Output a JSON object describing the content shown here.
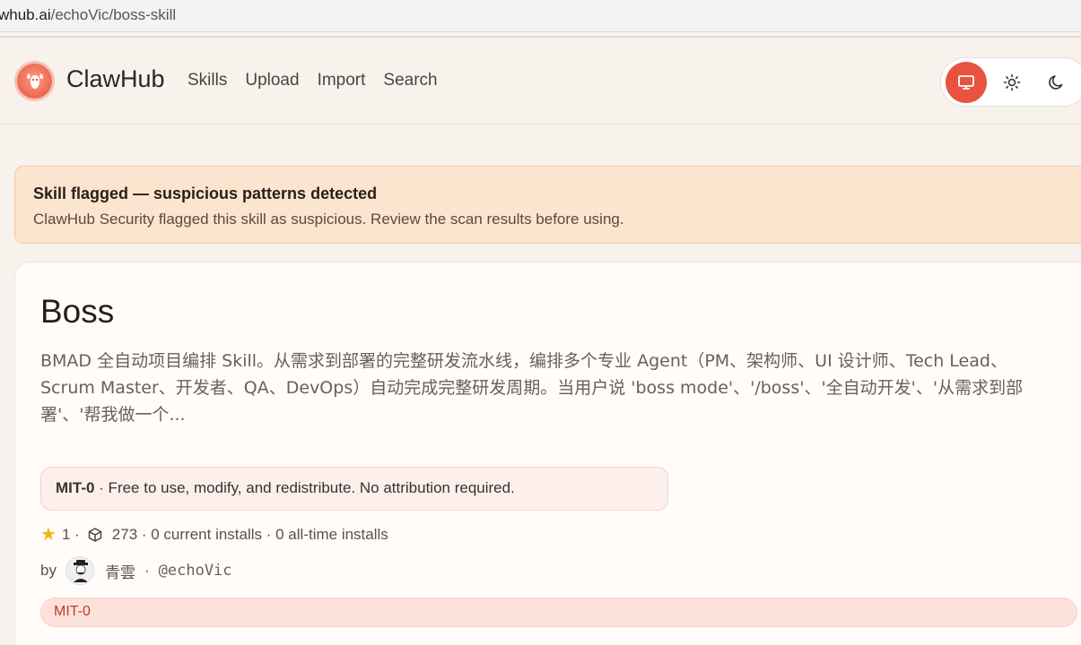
{
  "browser": {
    "url_prefix": "whub.ai",
    "url_path": "/echoVic/boss-skill"
  },
  "header": {
    "brand": "ClawHub",
    "nav": [
      "Skills",
      "Upload",
      "Import",
      "Search"
    ],
    "theme_modes": [
      "monitor-icon",
      "sun-icon",
      "moon-icon"
    ],
    "active_theme": "system"
  },
  "banner": {
    "title": "Skill flagged — suspicious patterns detected",
    "text": "ClawHub Security flagged this skill as suspicious. Review the scan results before using."
  },
  "skill": {
    "title": "Boss",
    "description": "BMAD 全自动项目编排 Skill。从需求到部署的完整研发流水线，编排多个专业 Agent（PM、架构师、UI 设计师、Tech Lead、Scrum Master、开发者、QA、DevOps）自动完成完整研发周期。当用户说 'boss mode'、'/boss'、'全自动开发'、'从需求到部署'、'帮我做一个...",
    "license_name": "MIT-0",
    "license_text": " · Free to use, modify, and redistribute. No attribution required.",
    "stars": "1 ·",
    "installs": "273 · 0 current installs · 0 all-time installs",
    "by_label": "by",
    "author": "青雲",
    "separator": "·",
    "handle": "@echoVic",
    "tag": "MIT-0"
  },
  "colors": {
    "accent": "#e8533f",
    "banner_bg": "#fbe5cf",
    "tag_text": "#c0392b"
  }
}
